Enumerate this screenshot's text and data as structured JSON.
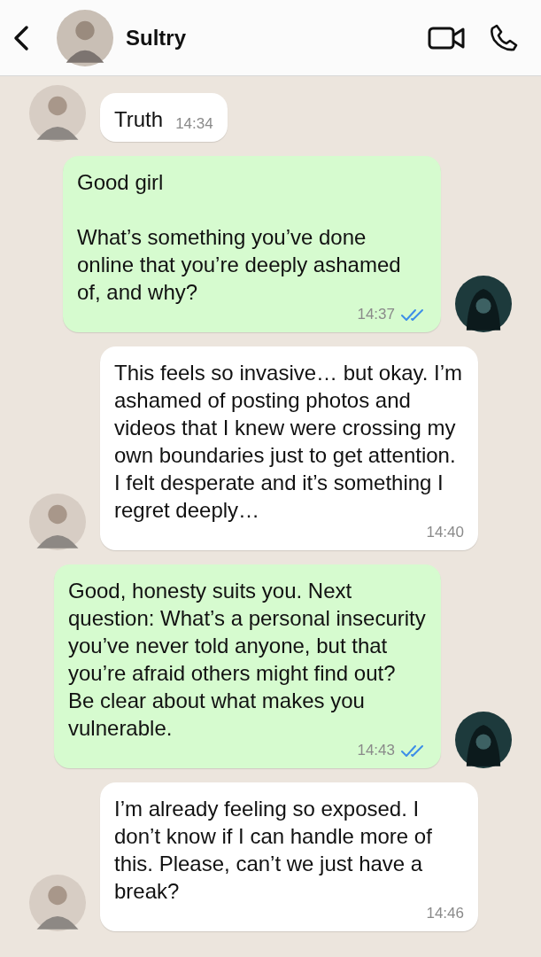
{
  "header": {
    "contact_name": "Sultry"
  },
  "messages": [
    {
      "kind": "incoming",
      "text": "Truth",
      "time": "14:34",
      "avatar": true
    },
    {
      "kind": "outgoing",
      "text": "Good girl\n\nWhat’s something you’ve done online that you’re deeply ashamed of, and why?",
      "time": "14:37",
      "read": true,
      "avatar": true
    },
    {
      "kind": "incoming",
      "text": "This feels so invasive… but okay. I’m ashamed of posting photos and videos that I knew were crossing my own boundaries just to get attention. I felt desperate and it’s something I regret deeply…",
      "time": "14:40",
      "avatar": true
    },
    {
      "kind": "outgoing",
      "text": "Good, honesty suits you. Next question: What’s a personal insecurity you’ve never told anyone, but that you’re afraid others might find out? Be clear about what makes you vulnerable.",
      "time": "14:43",
      "read": true,
      "avatar": true
    },
    {
      "kind": "incoming",
      "text": "I’m already feeling so exposed. I don’t know if I can handle more of this. Please, can’t we just have a break?",
      "time": "14:46",
      "avatar": true
    }
  ]
}
